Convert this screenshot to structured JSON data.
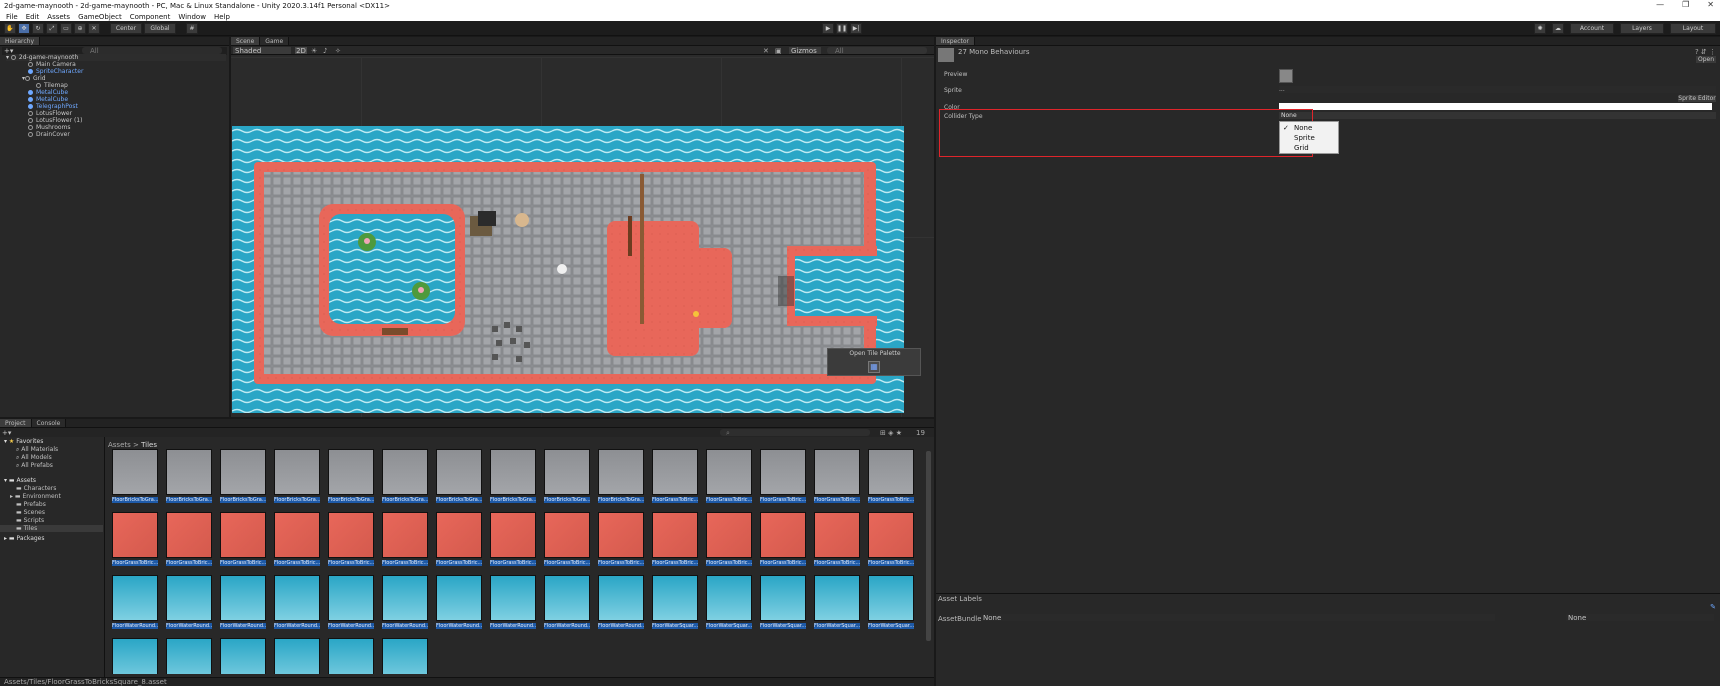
{
  "window": {
    "title": "2d-game-maynooth - 2d-game-maynooth - PC, Mac & Linux Standalone - Unity 2020.3.14f1 Personal <DX11>",
    "controls": [
      "—",
      "❐",
      "✕"
    ]
  },
  "menu": [
    "File",
    "Edit",
    "Assets",
    "GameObject",
    "Component",
    "Window",
    "Help"
  ],
  "toolbar": {
    "pivot_label": "Center",
    "space_label": "Global",
    "account_label": "Account",
    "layers_label": "Layers",
    "layout_label": "Layout"
  },
  "hierarchy": {
    "tab": "Hierarchy",
    "search_placeholder": "All",
    "items": [
      {
        "label": "2d-game-maynooth",
        "depth": 0,
        "blue": false
      },
      {
        "label": "Main Camera",
        "depth": 1,
        "blue": false
      },
      {
        "label": "SpriteCharacter",
        "depth": 1,
        "blue": true
      },
      {
        "label": "Grid",
        "depth": 1,
        "blue": false
      },
      {
        "label": "Tilemap",
        "depth": 2,
        "blue": false
      },
      {
        "label": "MetalCube",
        "depth": 1,
        "blue": true
      },
      {
        "label": "MetalCube",
        "depth": 1,
        "blue": true
      },
      {
        "label": "TelegraphPost",
        "depth": 1,
        "blue": true
      },
      {
        "label": "LotusFlower",
        "depth": 1,
        "blue": false
      },
      {
        "label": "LotusFlower (1)",
        "depth": 1,
        "blue": false
      },
      {
        "label": "Mushrooms",
        "depth": 1,
        "blue": false
      },
      {
        "label": "DrainCover",
        "depth": 1,
        "blue": false
      }
    ]
  },
  "scene": {
    "tabs": [
      "Scene",
      "Game"
    ],
    "shading_mode": "Shaded",
    "mode_2d": "2D",
    "gizmos_label": "Gizmos",
    "search_placeholder": "All",
    "overlay_title": "Open Tile Palette"
  },
  "inspector": {
    "tab": "Inspector",
    "header": "27 Mono Behaviours",
    "open_button": "Open",
    "preview_label": "Preview",
    "sprite_label": "Sprite",
    "sprite_value": "...",
    "sprite_editor_button": "Sprite Editor",
    "color_label": "Color",
    "collider_type_label": "Collider Type",
    "collider_type_value": "None",
    "dropdown_options": [
      "None",
      "Sprite",
      "Grid"
    ],
    "dropdown_selected": "None",
    "asset_labels": "Asset Labels",
    "asset_bundle_label": "AssetBundle",
    "asset_bundle_value": "None",
    "asset_bundle_variant": "None",
    "highlight_color": "#e0252b"
  },
  "project": {
    "tabs": [
      "Project",
      "Console"
    ],
    "breadcrumb": [
      "Assets",
      "Tiles"
    ],
    "count": "19",
    "favorites_label": "Favorites",
    "favorites": [
      "All Materials",
      "All Models",
      "All Prefabs"
    ],
    "assets_label": "Assets",
    "folders": [
      "Characters",
      "Environment",
      "Prefabs",
      "Scenes",
      "Scripts",
      "Tiles"
    ],
    "packages_label": "Packages",
    "status_path": "Assets/Tiles/FloorGrassToBricksSquare_8.asset",
    "rows": [
      [
        "FloorBricksToGra...",
        "FloorBricksToGra...",
        "FloorBricksToGra...",
        "FloorBricksToGra...",
        "FloorBricksToGra...",
        "FloorBricksToGra...",
        "FloorBricksToGra...",
        "FloorBricksToGra...",
        "FloorBricksToGra...",
        "FloorBricksToGra...",
        "FloorGrassToBric...",
        "FloorGrassToBric...",
        "FloorGrassToBric...",
        "FloorGrassToBric...",
        "FloorGrassToBric..."
      ],
      [
        "FloorGrassToBric...",
        "FloorGrassToBric...",
        "FloorGrassToBric...",
        "FloorGrassToBric...",
        "FloorGrassToBric...",
        "FloorGrassToBric...",
        "FloorGrassToBric...",
        "FloorGrassToBric...",
        "FloorGrassToBric...",
        "FloorGrassToBric...",
        "FloorGrassToBric...",
        "FloorGrassToBric...",
        "FloorGrassToBric...",
        "FloorGrassToBric...",
        "FloorGrassToBric..."
      ],
      [
        "FloorWaterRound...",
        "FloorWaterRound...",
        "FloorWaterRound...",
        "FloorWaterRound...",
        "FloorWaterRound...",
        "FloorWaterRound...",
        "FloorWaterRound...",
        "FloorWaterRound...",
        "FloorWaterRound...",
        "FloorWaterRound...",
        "FloorWaterSquar...",
        "FloorWaterSquar...",
        "FloorWaterSquar...",
        "FloorWaterSquar...",
        "FloorWaterSquar..."
      ]
    ]
  }
}
